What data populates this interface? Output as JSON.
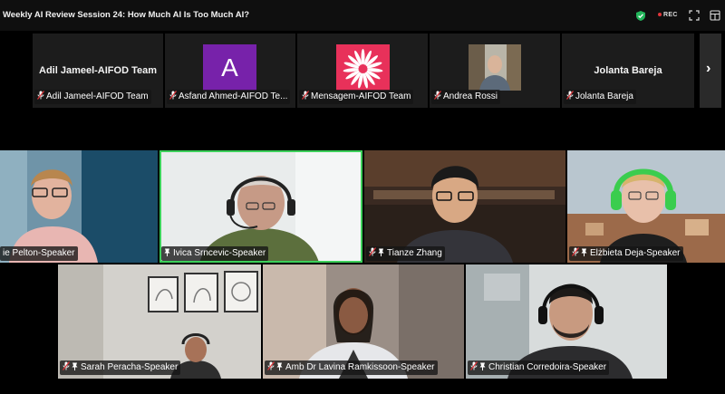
{
  "window": {
    "title": "Weekly AI Review Session 24: How Much AI Is Too Much AI?",
    "rec_label": "REC"
  },
  "strip": {
    "participants": [
      {
        "center_name": "Adil Jameel-AIFOD Team",
        "label": "Adil Jameel-AIFOD Team",
        "type": "name-only"
      },
      {
        "avatar_letter": "A",
        "label": "Asfand Ahmed-AIFOD Te...",
        "type": "letter-avatar",
        "color": "#7722aa"
      },
      {
        "label": "Mensagem-AIFOD Team",
        "type": "logo-avatar",
        "color": "#e8315a"
      },
      {
        "label": "Andrea Rossi",
        "type": "photo-avatar"
      },
      {
        "center_name": "Jolanta Bareja",
        "label": "Jolanta Bareja",
        "type": "name-only"
      }
    ],
    "next_icon": "chevron-right-icon"
  },
  "gallery": {
    "row1": [
      {
        "label": "ie Pelton-Speaker",
        "muted": false,
        "pinned": false
      },
      {
        "label": "Ivica Srncevic-Speaker",
        "muted": false,
        "pinned": true,
        "active": true
      },
      {
        "label": "Tianze Zhang",
        "muted": true,
        "pinned": true
      },
      {
        "label": "Elżbieta Deja-Speaker",
        "muted": true,
        "pinned": true
      }
    ],
    "row2": [
      {
        "label": "Sarah Peracha-Speaker",
        "muted": true,
        "pinned": true
      },
      {
        "label": "Amb Dr Lavina Ramkissoon-Speaker",
        "muted": true,
        "pinned": true
      },
      {
        "label": "Christian Corredoira-Speaker",
        "muted": true,
        "pinned": true
      }
    ]
  },
  "colors": {
    "active_speaker": "#3cd05a",
    "muted_mic": "#e0353a",
    "secure": "#22b45a"
  }
}
